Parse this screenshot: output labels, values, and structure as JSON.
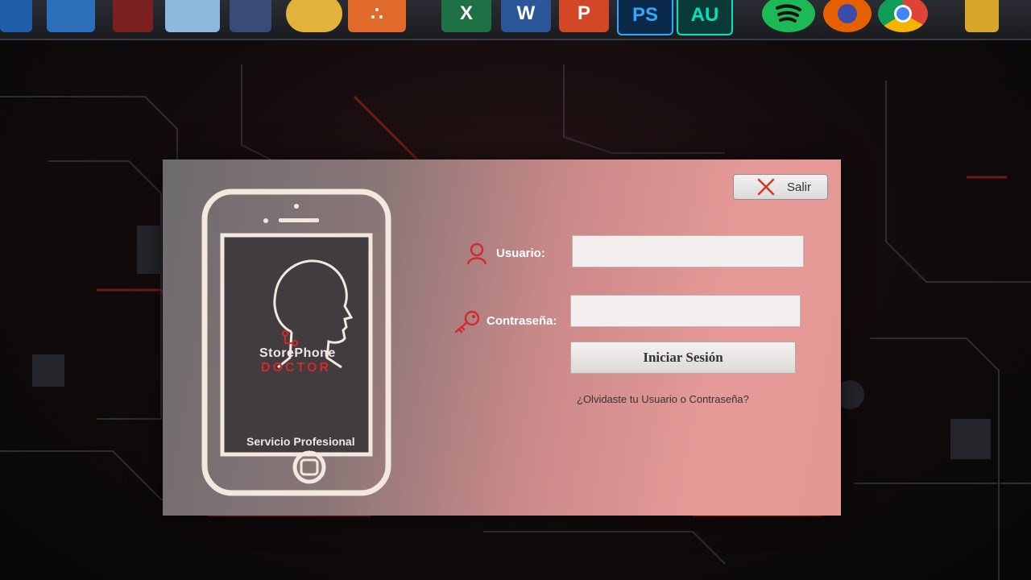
{
  "taskbar": {
    "icons": [
      {
        "name": "excel-icon",
        "label": "X",
        "color": "#1e7145"
      },
      {
        "name": "word-icon",
        "label": "W",
        "color": "#2b579a"
      },
      {
        "name": "powerpoint-icon",
        "label": "P",
        "color": "#d24726"
      },
      {
        "name": "photoshop-icon",
        "label": "PS",
        "color": "#0b2a4a"
      },
      {
        "name": "audition-icon",
        "label": "AU",
        "color": "#0a3a36"
      }
    ]
  },
  "login": {
    "exit_label": "Salir",
    "brand_line1": "StorePhone",
    "brand_line2": "DOCTOR",
    "tagline": "Servicio Profesional",
    "username_label": "Usuario:",
    "username_value": "",
    "password_label": "Contraseña:",
    "password_value": "",
    "submit_label": "Iniciar Sesión",
    "forgot_link": "¿Olvidaste tu Usuario o Contraseña?"
  },
  "colors": {
    "accent_red": "#d02a2a",
    "window_gradient_end": "#e59a97"
  }
}
